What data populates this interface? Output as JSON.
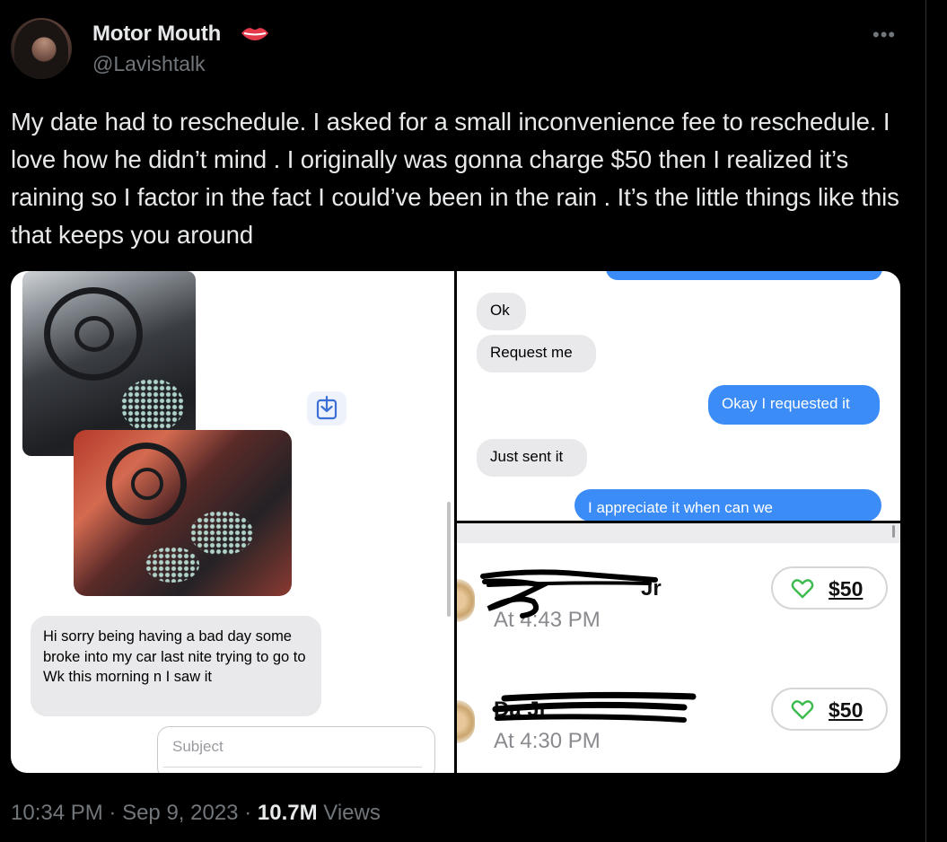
{
  "author": {
    "display_name": "Motor Mouth",
    "handle": "@Lavishtalk",
    "badge_icon": "lips-icon"
  },
  "tweet": {
    "text": "My date had to reschedule. I asked for a small inconvenience fee to reschedule. I love how he didn’t mind . I originally was gonna charge $50 then I realized it’s raining so I factor in the fact I could’ve been in the rain . It’s the little things like this that keeps you around"
  },
  "media": {
    "left_panel": {
      "message": "Hi sorry being having a bad day some broke into my car last nite trying to go to Wk this morning n I saw it",
      "subject_placeholder": "Subject"
    },
    "chat": {
      "messages": [
        {
          "side": "received",
          "text": "Ok"
        },
        {
          "side": "received",
          "text": "Request me"
        },
        {
          "side": "sent",
          "text": "Okay I requested it"
        },
        {
          "side": "received",
          "text": "Just sent it"
        },
        {
          "side": "sent",
          "text": "I appreciate it when can we"
        }
      ]
    },
    "payments": [
      {
        "name": "Jr",
        "time": "At 4:43 PM",
        "amount": "$50"
      },
      {
        "name": "Da                 Jr",
        "time": "At 4:30 PM",
        "amount": "$50"
      }
    ]
  },
  "footer": {
    "time": "10:34 PM",
    "date": "Sep 9, 2023",
    "views_count": "10.7M",
    "views_label": "Views",
    "separator": "·"
  },
  "colors": {
    "background": "#000000",
    "text_primary": "#e7e9ea",
    "text_secondary": "#71767b",
    "imessage_blue": "#3b8cf7",
    "imessage_gray": "#e9e9eb",
    "like_green": "#3dbb4f",
    "lips_red": "#e23a4a"
  }
}
